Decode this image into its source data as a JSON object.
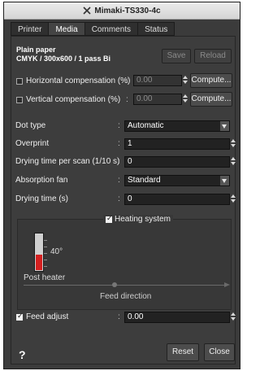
{
  "window": {
    "title": "Mimaki-TS330-4c"
  },
  "tabs": [
    {
      "label": "Printer",
      "active": false
    },
    {
      "label": "Media",
      "active": true
    },
    {
      "label": "Comments",
      "active": false
    },
    {
      "label": "Status",
      "active": false
    }
  ],
  "media": {
    "name": "Plain paper",
    "mode": "CMYK / 300x600 / 1 pass Bi"
  },
  "header_buttons": {
    "save": "Save",
    "reload": "Reload"
  },
  "rows": {
    "hcomp": {
      "label": "Horizontal compensation (%)",
      "value": "0.00",
      "checked": false,
      "compute": "Compute..."
    },
    "vcomp": {
      "label": "Vertical compensation (%)",
      "value": "0.00",
      "checked": false,
      "compute": "Compute..."
    },
    "dot_type": {
      "label": "Dot type",
      "value": "Automatic"
    },
    "overprint": {
      "label": "Overprint",
      "value": "1"
    },
    "drying_scan": {
      "label": "Drying time per scan (1/10 s)",
      "value": "0"
    },
    "absorption_fan": {
      "label": "Absorption fan",
      "value": "Standard"
    },
    "drying_time": {
      "label": "Drying time (s)",
      "value": "0"
    }
  },
  "colon": ":",
  "heating": {
    "label": "Heating system",
    "checked": true,
    "temperature": "40°",
    "temperature_fill": 0.42,
    "heater_label": "Post heater",
    "feed_direction": "Feed direction"
  },
  "feed_adjust": {
    "label": "Feed adjust",
    "value": "0.00",
    "checked": true
  },
  "footer": {
    "help": "?",
    "reset": "Reset",
    "close": "Close"
  }
}
